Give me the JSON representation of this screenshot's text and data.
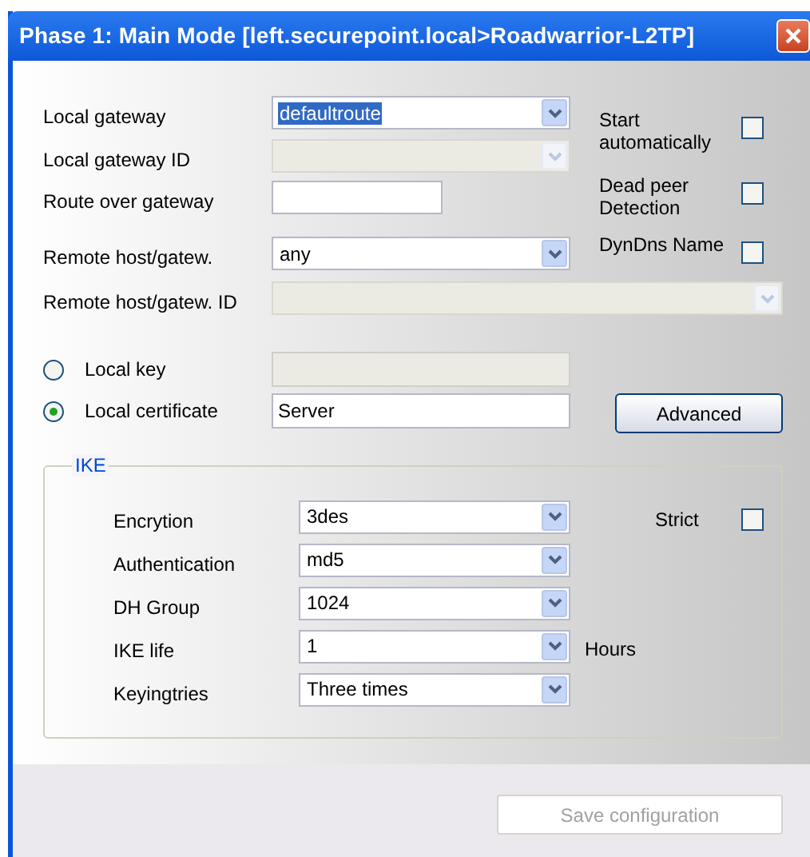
{
  "window": {
    "title": "Phase 1: Main Mode [left.securepoint.local>Roadwarrior-L2TP]"
  },
  "fields": [
    {
      "kind": "combo",
      "label": "Local gateway",
      "value": "defaultroute",
      "highlighted": true,
      "disabled": false
    },
    {
      "kind": "combo",
      "label": "Local gateway ID",
      "disabled": true
    },
    {
      "kind": "text",
      "label": "Route over gateway",
      "disabled": false
    },
    {
      "kind": "combo",
      "label": "Remote host/gatew.",
      "value": "any",
      "highlighted": false,
      "disabled": false
    },
    {
      "kind": "combo",
      "label": "Remote host/gatew. ID",
      "disabled": true
    }
  ],
  "options": [
    {
      "label": "Start automatically",
      "checked": false
    },
    {
      "label": "Dead peer Detection",
      "checked": false
    },
    {
      "label": "DynDns Name",
      "checked": false
    }
  ],
  "key_source": [
    {
      "label": "Local key",
      "selected": false,
      "disabled": true
    },
    {
      "label": "Local certificate",
      "selected": true,
      "value": "Server",
      "disabled": false
    }
  ],
  "advanced_button": {
    "label": "Advanced"
  },
  "ike": {
    "legend": "IKE",
    "fields": [
      {
        "label": "Encrytion",
        "value": "3des"
      },
      {
        "label": "Authentication",
        "value": "md5"
      },
      {
        "label": "DH Group",
        "value": "1024"
      },
      {
        "label": "IKE life",
        "value": "1",
        "suffix": "Hours"
      },
      {
        "label": "Keyingtries",
        "value": "Three times"
      }
    ],
    "strict": {
      "label": "Strict",
      "checked": false
    }
  },
  "save_button": {
    "label": "Save configuration",
    "disabled": true
  }
}
